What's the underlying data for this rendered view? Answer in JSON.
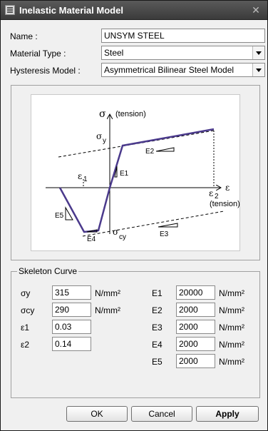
{
  "window": {
    "title": "Inelastic Material Model",
    "close_glyph": "✕"
  },
  "form": {
    "name_label": "Name :",
    "name_value": "UNSYM STEEL",
    "material_type_label": "Material Type :",
    "material_type_value": "Steel",
    "hysteresis_label": "Hysteresis Model :",
    "hysteresis_value": "Asymmetrical Bilinear Steel Model"
  },
  "diagram": {
    "sigma": "σ",
    "sigma_tension": "(tension)",
    "sigma_y": "σ",
    "sigma_y_sub": "y",
    "sigma_cy": "σ",
    "sigma_cy_sub": "cy",
    "eps": "ε",
    "eps1": "ε",
    "eps1_sub": "1",
    "eps2": "ε",
    "eps2_sub": "2",
    "eps_tension": "(tension)",
    "E1": "E1",
    "E2": "E2",
    "E3": "E3",
    "E4": "E4",
    "E5": "E5",
    "curve_color": "#4b3a8c"
  },
  "skeleton": {
    "title": "Skeleton Curve",
    "unit": "N/mm²",
    "left": [
      {
        "label": "σy",
        "value": "315",
        "unit": "N/mm²"
      },
      {
        "label": "σcy",
        "value": "290",
        "unit": "N/mm²"
      },
      {
        "label": "ε1",
        "value": "0.03",
        "unit": ""
      },
      {
        "label": "ε2",
        "value": "0.14",
        "unit": ""
      }
    ],
    "right": [
      {
        "label": "E1",
        "value": "20000",
        "unit": "N/mm²"
      },
      {
        "label": "E2",
        "value": "2000",
        "unit": "N/mm²"
      },
      {
        "label": "E3",
        "value": "2000",
        "unit": "N/mm²"
      },
      {
        "label": "E4",
        "value": "2000",
        "unit": "N/mm²"
      },
      {
        "label": "E5",
        "value": "2000",
        "unit": "N/mm²"
      }
    ]
  },
  "buttons": {
    "ok": "OK",
    "cancel": "Cancel",
    "apply": "Apply"
  }
}
